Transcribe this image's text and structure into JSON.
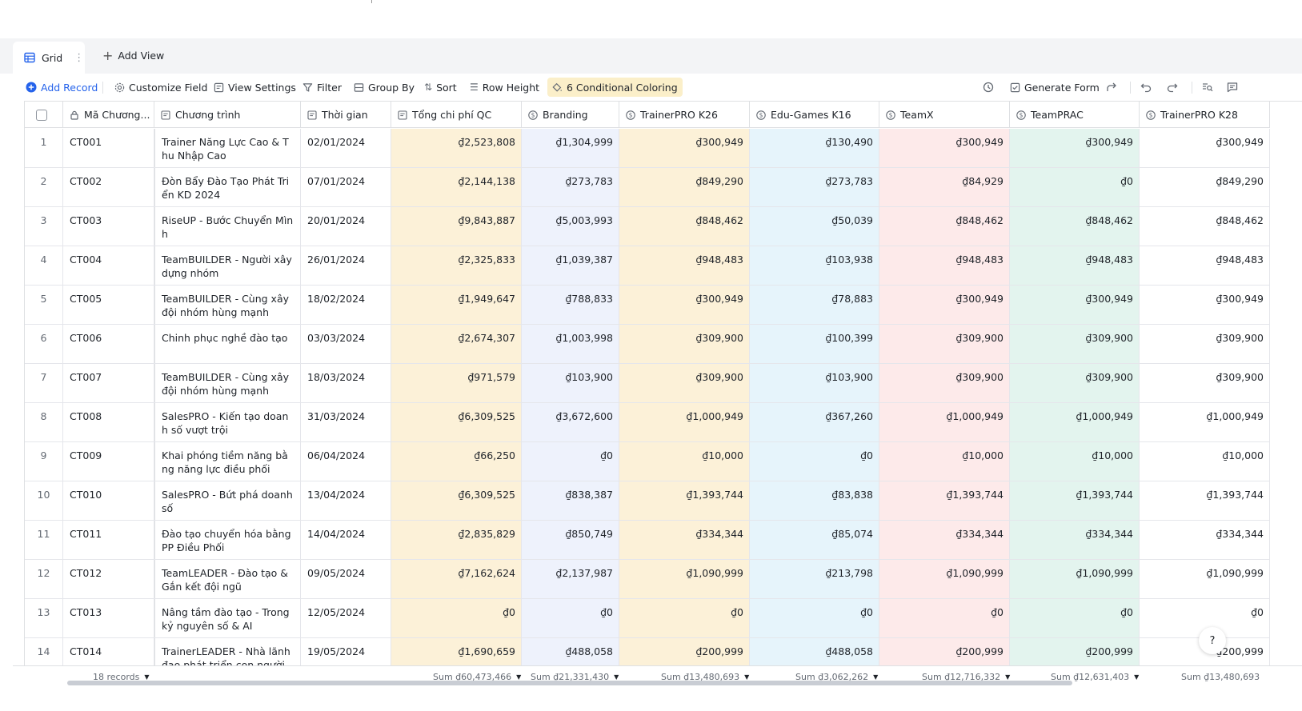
{
  "view_tabs": {
    "grid_label": "Grid",
    "add_view_label": "Add View"
  },
  "toolbar": {
    "add_record": "Add Record",
    "customize_field": "Customize Field",
    "view_settings": "View Settings",
    "filter": "Filter",
    "group_by": "Group By",
    "sort": "Sort",
    "row_height": "Row Height",
    "conditional_coloring": "6 Conditional Coloring",
    "generate_form": "Generate Form"
  },
  "columns": [
    {
      "key": "code",
      "label": "Mã Chương...",
      "icon": "lock-icon"
    },
    {
      "key": "program",
      "label": "Chương trình",
      "icon": "text-field-icon"
    },
    {
      "key": "date",
      "label": "Thời gian",
      "icon": "text-field-icon"
    },
    {
      "key": "total",
      "label": "Tổng chi phí QC",
      "icon": "text-field-icon",
      "color": "#fcf1d8"
    },
    {
      "key": "branding",
      "label": "Branding",
      "icon": "currency-icon",
      "color": "#eef2fc"
    },
    {
      "key": "k26",
      "label": "TrainerPRO K26",
      "icon": "currency-icon",
      "color": "#fcf1d8"
    },
    {
      "key": "edu",
      "label": "Edu-Games K16",
      "icon": "currency-icon",
      "color": "#e6f4fb"
    },
    {
      "key": "teamx",
      "label": "TeamX",
      "icon": "currency-icon",
      "color": "#fdeaea"
    },
    {
      "key": "prac",
      "label": "TeamPRAC",
      "icon": "currency-icon",
      "color": "#e3f4ee"
    },
    {
      "key": "k28",
      "label": "TrainerPRO K28",
      "icon": "currency-icon",
      "color": "#ffffff"
    }
  ],
  "rows": [
    {
      "n": "1",
      "code": "CT001",
      "program": "Trainer Năng Lực Cao & Thu Nhập Cao",
      "date": "02/01/2024",
      "total": "₫2,523,808",
      "branding": "₫1,304,999",
      "k26": "₫300,949",
      "edu": "₫130,490",
      "teamx": "₫300,949",
      "prac": "₫300,949",
      "k28": "₫300,949"
    },
    {
      "n": "2",
      "code": "CT002",
      "program": "Đòn Bẩy Đào Tạo Phát Triển KD 2024",
      "date": "07/01/2024",
      "total": "₫2,144,138",
      "branding": "₫273,783",
      "k26": "₫849,290",
      "edu": "₫273,783",
      "teamx": "₫84,929",
      "prac": "₫0",
      "k28": "₫849,290"
    },
    {
      "n": "3",
      "code": "CT003",
      "program": "RiseUP - Bước Chuyển Mình",
      "date": "20/01/2024",
      "total": "₫9,843,887",
      "branding": "₫5,003,993",
      "k26": "₫848,462",
      "edu": "₫50,039",
      "teamx": "₫848,462",
      "prac": "₫848,462",
      "k28": "₫848,462"
    },
    {
      "n": "4",
      "code": "CT004",
      "program": "TeamBUILDER - Người xây dựng nhóm",
      "date": "26/01/2024",
      "total": "₫2,325,833",
      "branding": "₫1,039,387",
      "k26": "₫948,483",
      "edu": "₫103,938",
      "teamx": "₫948,483",
      "prac": "₫948,483",
      "k28": "₫948,483"
    },
    {
      "n": "5",
      "code": "CT005",
      "program": "TeamBUILDER - Cùng xây đội nhóm hùng mạnh",
      "date": "18/02/2024",
      "total": "₫1,949,647",
      "branding": "₫788,833",
      "k26": "₫300,949",
      "edu": "₫78,883",
      "teamx": "₫300,949",
      "prac": "₫300,949",
      "k28": "₫300,949"
    },
    {
      "n": "6",
      "code": "CT006",
      "program": "Chinh phục nghề đào tạo",
      "date": "03/03/2024",
      "total": "₫2,674,307",
      "branding": "₫1,003,998",
      "k26": "₫309,900",
      "edu": "₫100,399",
      "teamx": "₫309,900",
      "prac": "₫309,900",
      "k28": "₫309,900"
    },
    {
      "n": "7",
      "code": "CT007",
      "program": "TeamBUILDER - Cùng xây đội nhóm hùng mạnh",
      "date": "18/03/2024",
      "total": "₫971,579",
      "branding": "₫103,900",
      "k26": "₫309,900",
      "edu": "₫103,900",
      "teamx": "₫309,900",
      "prac": "₫309,900",
      "k28": "₫309,900"
    },
    {
      "n": "8",
      "code": "CT008",
      "program": "SalesPRO - Kiến tạo doanh số vượt trội",
      "date": "31/03/2024",
      "total": "₫6,309,525",
      "branding": "₫3,672,600",
      "k26": "₫1,000,949",
      "edu": "₫367,260",
      "teamx": "₫1,000,949",
      "prac": "₫1,000,949",
      "k28": "₫1,000,949"
    },
    {
      "n": "9",
      "code": "CT009",
      "program": "Khai phóng tiềm năng bằng năng lực điều phối",
      "date": "06/04/2024",
      "total": "₫66,250",
      "branding": "₫0",
      "k26": "₫10,000",
      "edu": "₫0",
      "teamx": "₫10,000",
      "prac": "₫10,000",
      "k28": "₫10,000"
    },
    {
      "n": "10",
      "code": "CT010",
      "program": "SalesPRO - Bứt phá doanh số",
      "date": "13/04/2024",
      "total": "₫6,309,525",
      "branding": "₫838,387",
      "k26": "₫1,393,744",
      "edu": "₫83,838",
      "teamx": "₫1,393,744",
      "prac": "₫1,393,744",
      "k28": "₫1,393,744"
    },
    {
      "n": "11",
      "code": "CT011",
      "program": "Đào tạo chuyển hóa bằng PP Điều Phối",
      "date": "14/04/2024",
      "total": "₫2,835,829",
      "branding": "₫850,749",
      "k26": "₫334,344",
      "edu": "₫85,074",
      "teamx": "₫334,344",
      "prac": "₫334,344",
      "k28": "₫334,344"
    },
    {
      "n": "12",
      "code": "CT012",
      "program": "TeamLEADER - Đào tạo & Gắn kết đội ngũ",
      "date": "09/05/2024",
      "total": "₫7,162,624",
      "branding": "₫2,137,987",
      "k26": "₫1,090,999",
      "edu": "₫213,798",
      "teamx": "₫1,090,999",
      "prac": "₫1,090,999",
      "k28": "₫1,090,999"
    },
    {
      "n": "13",
      "code": "CT013",
      "program": "Nâng tầm đào tạo - Trong kỷ nguyên số & AI",
      "date": "12/05/2024",
      "total": "₫0",
      "branding": "₫0",
      "k26": "₫0",
      "edu": "₫0",
      "teamx": "₫0",
      "prac": "₫0",
      "k28": "₫0"
    },
    {
      "n": "14",
      "code": "CT014",
      "program": "TrainerLEADER - Nhà lãnh đạo phát triển con người",
      "date": "19/05/2024",
      "total": "₫1,690,659",
      "branding": "₫488,058",
      "k26": "₫200,999",
      "edu": "₫488,058",
      "teamx": "₫200,999",
      "prac": "₫200,999",
      "k28": "₫200,999"
    }
  ],
  "footer": {
    "records": "18 records",
    "sum_total": "Sum ₫60,473,466",
    "sum_branding": "Sum ₫21,331,430",
    "sum_k26": "Sum ₫13,480,693",
    "sum_edu": "Sum ₫3,062,262",
    "sum_teamx": "Sum ₫12,716,332",
    "sum_prac": "Sum ₫12,631,403",
    "sum_k28": "Sum ₫13,480,693"
  },
  "help_label": "?"
}
